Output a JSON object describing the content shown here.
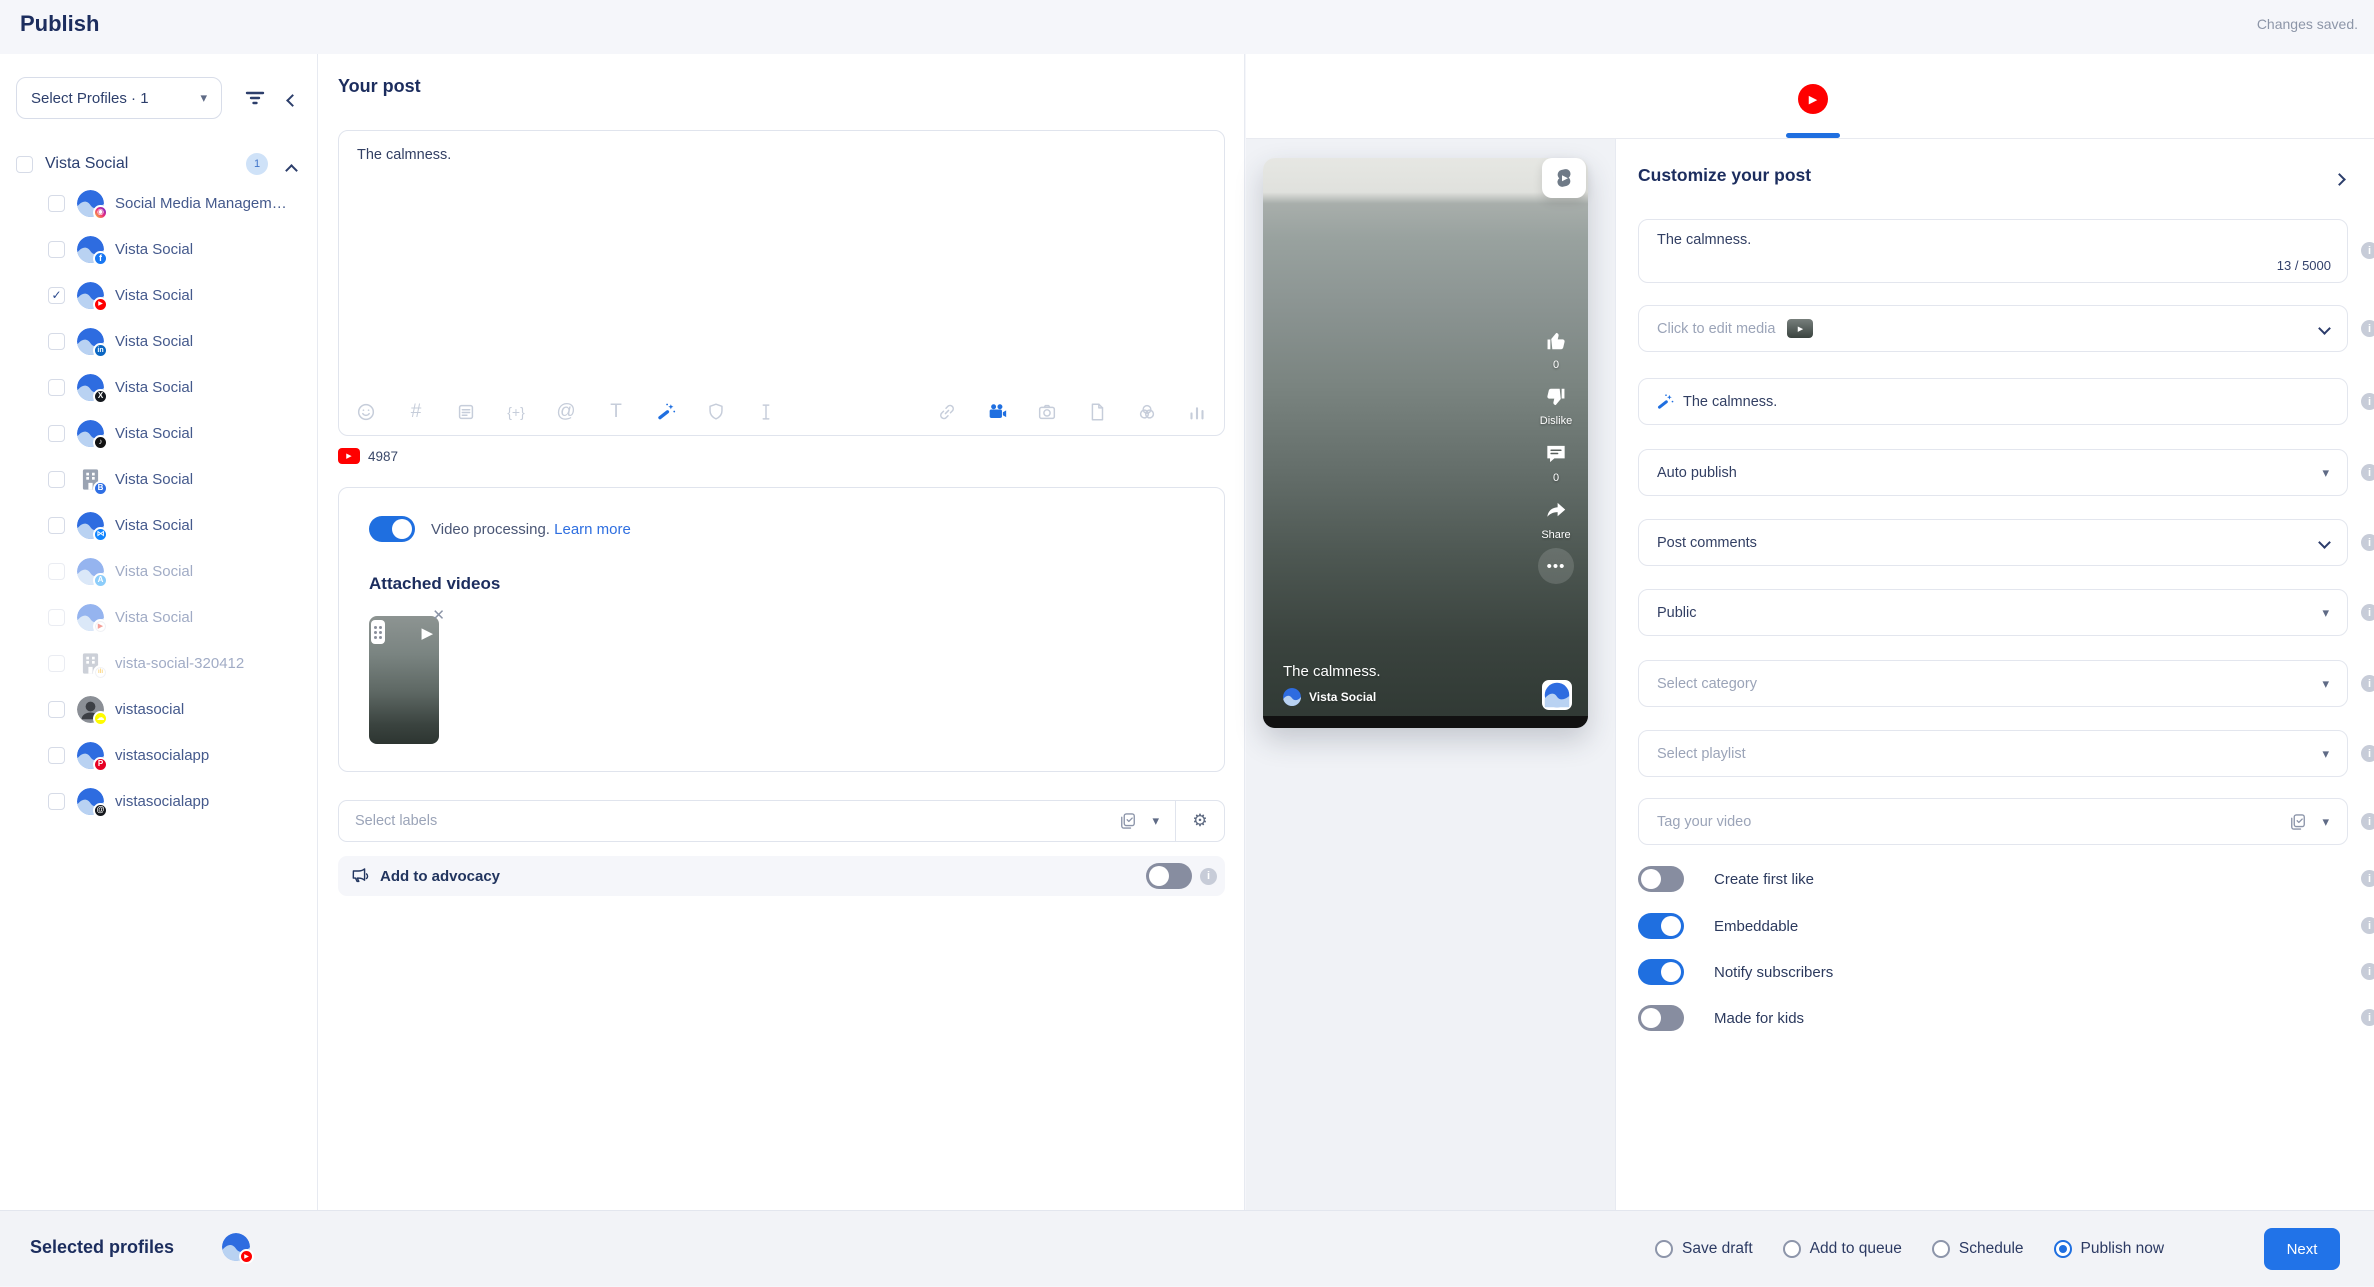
{
  "colors": {
    "accent": "#1f6fe0",
    "youtube_red": "#ff0000"
  },
  "header": {
    "title": "Publish",
    "status": "Changes saved."
  },
  "sidebar": {
    "select_profiles": "Select Profiles · 1",
    "group_name": "Vista Social",
    "group_count": "1",
    "profiles": [
      {
        "label": "Social Media Managem…",
        "network": "instagram",
        "avatar": "vs",
        "checked": false,
        "disabled": false
      },
      {
        "label": "Vista Social",
        "network": "facebook",
        "avatar": "vs",
        "checked": false,
        "disabled": false
      },
      {
        "label": "Vista Social",
        "network": "youtube",
        "avatar": "vs",
        "checked": true,
        "disabled": false
      },
      {
        "label": "Vista Social",
        "network": "linkedin",
        "avatar": "vs",
        "checked": false,
        "disabled": false
      },
      {
        "label": "Vista Social",
        "network": "x",
        "avatar": "vs",
        "checked": false,
        "disabled": false
      },
      {
        "label": "Vista Social",
        "network": "tiktok",
        "avatar": "vs",
        "checked": false,
        "disabled": false
      },
      {
        "label": "Vista Social",
        "network": "google-business",
        "avatar": "building",
        "checked": false,
        "disabled": false
      },
      {
        "label": "Vista Social",
        "network": "bluesky",
        "avatar": "vs",
        "checked": false,
        "disabled": false
      },
      {
        "label": "Vista Social",
        "network": "app-store",
        "avatar": "vs",
        "checked": false,
        "disabled": true
      },
      {
        "label": "Vista Social",
        "network": "google-play",
        "avatar": "vs",
        "checked": false,
        "disabled": true
      },
      {
        "label": "vista-social-320412",
        "network": "analytics",
        "avatar": "building",
        "checked": false,
        "disabled": true
      },
      {
        "label": "vistasocial",
        "network": "snapchat",
        "avatar": "person",
        "checked": false,
        "disabled": false
      },
      {
        "label": "vistasocialapp",
        "network": "pinterest",
        "avatar": "vs",
        "checked": false,
        "disabled": false
      },
      {
        "label": "vistasocialapp",
        "network": "threads",
        "avatar": "vs",
        "checked": false,
        "disabled": false
      }
    ]
  },
  "editor": {
    "heading": "Your post",
    "post_text": "The calmness.",
    "toolbar_left": [
      "emoji",
      "hashtag",
      "snippet",
      "variables",
      "mention",
      "text-case",
      "magic-wand",
      "shield",
      "clear-format"
    ],
    "toolbar_right": [
      "link",
      "video",
      "camera",
      "file",
      "media-library",
      "analytics"
    ],
    "active_icons": [
      "magic-wand",
      "video"
    ],
    "char_count": "4987",
    "video_processing": "Video processing.",
    "learn_more": "Learn more",
    "attached_videos": "Attached videos",
    "labels_placeholder": "Select labels",
    "advocacy": "Add to advocacy"
  },
  "preview": {
    "caption": "The calmness.",
    "channel": "Vista Social",
    "rail": [
      {
        "icon": "like",
        "label": "0"
      },
      {
        "icon": "dislike",
        "label": "Dislike"
      },
      {
        "icon": "comment",
        "label": "0"
      },
      {
        "icon": "share",
        "label": "Share"
      },
      {
        "icon": "more",
        "label": ""
      }
    ]
  },
  "customize": {
    "heading": "Customize your post",
    "caption_value": "The calmness.",
    "caption_counter": "13 / 5000",
    "rows": [
      {
        "id": "media",
        "label": "Click to edit media",
        "placeholder": true,
        "thumb": true,
        "caret": "chevron",
        "copy": false,
        "wand": false
      },
      {
        "id": "video-title",
        "label": "The calmness.",
        "placeholder": false,
        "thumb": false,
        "caret": "none",
        "copy": false,
        "wand": true
      },
      {
        "id": "publish-mode",
        "label": "Auto publish",
        "placeholder": false,
        "thumb": false,
        "caret": "filled",
        "copy": false,
        "wand": false
      },
      {
        "id": "post-comments",
        "label": "Post comments",
        "placeholder": false,
        "thumb": false,
        "caret": "chevron",
        "copy": false,
        "wand": false
      },
      {
        "id": "privacy",
        "label": "Public",
        "placeholder": false,
        "thumb": false,
        "caret": "filled",
        "copy": false,
        "wand": false
      },
      {
        "id": "category",
        "label": "Select category",
        "placeholder": true,
        "thumb": false,
        "caret": "filled",
        "copy": false,
        "wand": false
      },
      {
        "id": "playlist",
        "label": "Select playlist",
        "placeholder": true,
        "thumb": false,
        "caret": "filled",
        "copy": false,
        "wand": false
      },
      {
        "id": "tags",
        "label": "Tag your video",
        "placeholder": true,
        "thumb": false,
        "caret": "filled",
        "copy": true,
        "wand": false
      }
    ],
    "toggles": [
      {
        "label": "Create first like",
        "on": false
      },
      {
        "label": "Embeddable",
        "on": true
      },
      {
        "label": "Notify subscribers",
        "on": true
      },
      {
        "label": "Made for kids",
        "on": false
      }
    ]
  },
  "footer": {
    "selected_profiles": "Selected profiles",
    "options": [
      {
        "label": "Save draft",
        "selected": false
      },
      {
        "label": "Add to queue",
        "selected": false
      },
      {
        "label": "Schedule",
        "selected": false
      },
      {
        "label": "Publish now",
        "selected": true
      }
    ],
    "next": "Next"
  }
}
